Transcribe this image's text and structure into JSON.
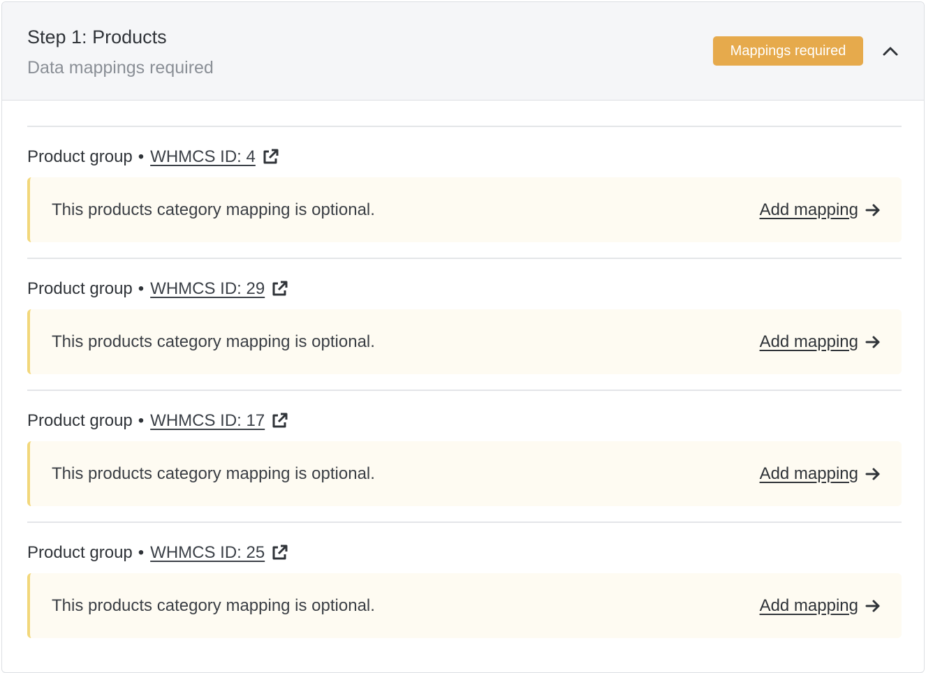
{
  "step": {
    "title": "Step 1: Products",
    "subtitle": "Data mappings required",
    "badge": "Mappings required",
    "collapse_icon": "chevron-up-icon",
    "badge_color": "#e6aa4c"
  },
  "groups": [
    {
      "type": "Product group",
      "separator": "•",
      "id_label": "WHMCS ID: 4",
      "notice": "This products category mapping is optional.",
      "action": "Add mapping"
    },
    {
      "type": "Product group",
      "separator": "•",
      "id_label": "WHMCS ID: 29",
      "notice": "This products category mapping is optional.",
      "action": "Add mapping"
    },
    {
      "type": "Product group",
      "separator": "•",
      "id_label": "WHMCS ID: 17",
      "notice": "This products category mapping is optional.",
      "action": "Add mapping"
    },
    {
      "type": "Product group",
      "separator": "•",
      "id_label": "WHMCS ID: 25",
      "notice": "This products category mapping is optional.",
      "action": "Add mapping"
    }
  ],
  "icons": {
    "external": "external-link-icon",
    "arrow": "arrow-right-icon"
  },
  "colors": {
    "notice_background": "#fefbf2",
    "notice_border": "#f2d77a"
  }
}
